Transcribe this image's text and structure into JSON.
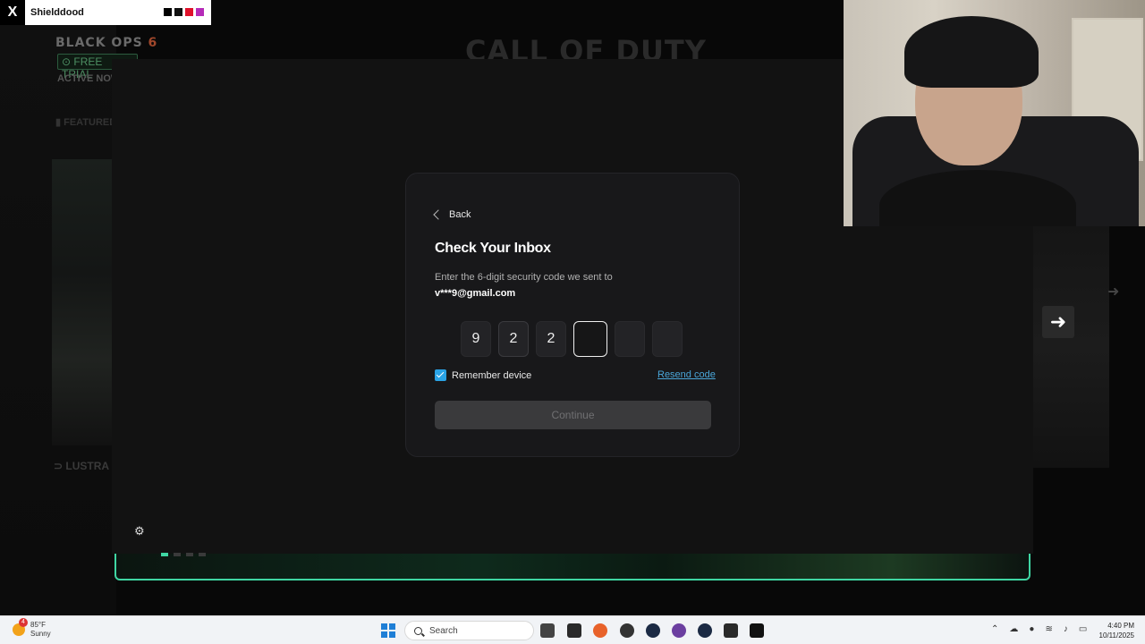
{
  "background": {
    "game_title": "BLACK OPS",
    "game_title_number": "6",
    "free_trial": "FREE TRIAL",
    "active_now": "ACTIVE NOW",
    "featured": "FEATURED",
    "brand_logo": "CALL OF DUTY",
    "section": "LUSTRA"
  },
  "x_post": {
    "logo": "X",
    "username": "Shielddood",
    "swatch_colors": [
      "#000000",
      "#111111",
      "#e0112b",
      "#b52bb8"
    ]
  },
  "modal": {
    "back_label": "Back",
    "title": "Check Your Inbox",
    "description": "Enter the 6-digit security code we sent to",
    "email": "v***9@gmail.com",
    "code_digits": [
      "9",
      "2",
      "2",
      "",
      "",
      ""
    ],
    "remember_label": "Remember device",
    "remember_checked": true,
    "resend_label": "Resend code",
    "continue_label": "Continue"
  },
  "taskbar": {
    "weather_temp": "85°F",
    "weather_desc": "Sunny",
    "weather_badge": "4",
    "search_placeholder": "Search",
    "time": "4:40 PM",
    "date": "10/11/2025"
  },
  "colors": {
    "accent": "#2aa3e6",
    "link": "#4aa6d9",
    "banner_border": "#3fd6a3"
  }
}
